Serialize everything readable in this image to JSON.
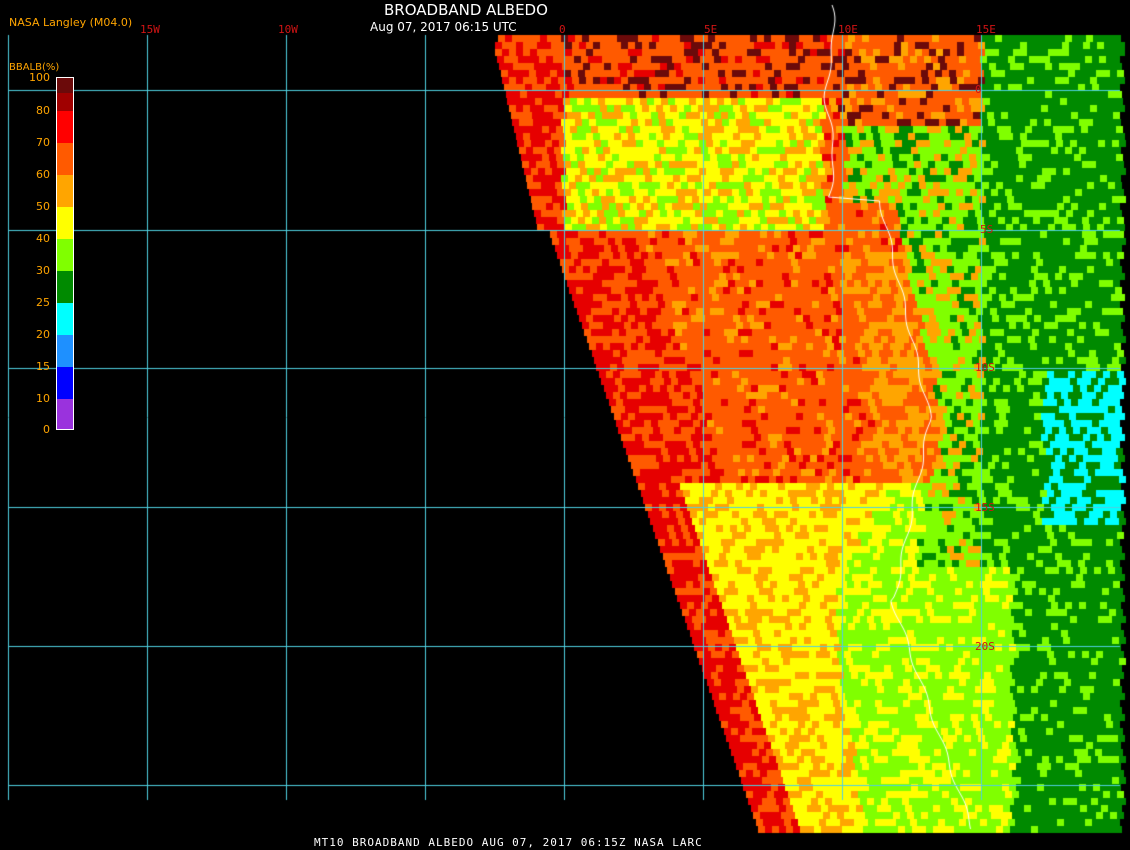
{
  "header": {
    "credit": "NASA Langley (M04.0)",
    "title": "BROADBAND ALBEDO",
    "subtitle": "Aug 07, 2017 06:15 UTC"
  },
  "footer": {
    "caption": "MT10  BROADBAND ALBEDO   AUG 07, 2017 06:15Z   NASA LARC"
  },
  "grid": {
    "lon_labels": [
      "15W",
      "10W",
      "0",
      "5E",
      "10E",
      "15E"
    ],
    "lat_labels": [
      "0",
      "5S",
      "10S",
      "15S",
      "20S"
    ],
    "line_color": "#4fd0e0"
  },
  "colorbar": {
    "title": "BBALB(%)",
    "ticks": [
      "100",
      "80",
      "70",
      "60",
      "50",
      "40",
      "30",
      "25",
      "20",
      "15",
      "10",
      "0"
    ],
    "colors": [
      "#6b0a0a",
      "#a00000",
      "#ff0000",
      "#ff5a00",
      "#ffa500",
      "#ffff00",
      "#80ff00",
      "#008a00",
      "#00ffff",
      "#1e90ff",
      "#0000ff",
      "#9a32dd"
    ]
  },
  "colors": {
    "background": "#000000",
    "coastline": "#ffffff"
  }
}
